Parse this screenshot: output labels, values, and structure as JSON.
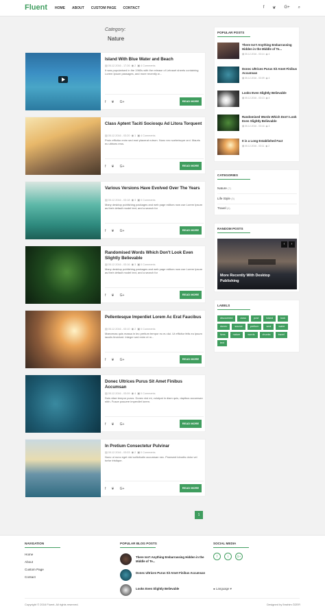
{
  "header": {
    "logo": "Fluent",
    "nav": [
      "HOME",
      "ABOUT",
      "CUSTOM PAGE",
      "CONTACT"
    ],
    "icons": [
      "f",
      "❦",
      "G+",
      "⌕"
    ]
  },
  "category": {
    "label": "Category:",
    "name": "Nature"
  },
  "posts": [
    {
      "title": "Island With Blue Water and Beach",
      "date": "05.12.2016 - 17:26",
      "views": "2",
      "comments": "4 Comments",
      "excerpt": "It was popularised in the 1960s with the release of Letraset sheets containing Lorem Ipsum passages, and more recently w...",
      "more": "READ MORE"
    },
    {
      "title": "Class Aptent Taciti Sociosqu Ad Litora Torquent",
      "date": "05.12.2016 - 03:20",
      "views": "1",
      "comments": "4 Comments",
      "excerpt": "Proin efficitur enim sed erat placerat rutrum. Nunc nec scelerisque orci. Mauris eu ultrices eros.",
      "more": "READ MORE"
    },
    {
      "title": "Various Versions Have Evolved Over The Years",
      "date": "05.12.2016 - 03:18",
      "views": "3",
      "comments": "0 Comments",
      "excerpt": "Many desktop publishing packages and web page editors now use Lorem Ipsum as their default model text, and a search for",
      "more": "READ MORE"
    },
    {
      "title": "Randomised Words Which Don't Look Even Slightly Believable",
      "date": "05.12.2016 - 03:16",
      "views": "3",
      "comments": "0 Comments",
      "excerpt": "Many desktop publishing packages and web page editors now use Lorem Ipsum as their default model text, and a search for",
      "more": "READ MORE"
    },
    {
      "title": "Pellentesque Imperdiet Lorem Ac Erat Faucibus",
      "date": "05.12.2016 - 03:10",
      "views": "2",
      "comments": "0 Comments",
      "excerpt": "Maecenas quis massa in leo pretium tempor eu eu dui. Ut efficitur felis eu ipsum iaculis tincidunt. Integer sed enim et m...",
      "more": "READ MORE"
    },
    {
      "title": "Donec Ultrices Purus Sit Amet Finibus Accumsan",
      "date": "05.12.2016 - 03:09",
      "views": "4",
      "comments": "0 Comments",
      "excerpt": "Duis vitae tempor purus. Donec nisl mi, volutpat in diam quis, dapibus accumsan nibh. Fusce posuere imperdiet lorem.",
      "more": "READ MORE"
    },
    {
      "title": "In Pretium Consectetur Pulvinar",
      "date": "05.12.2016 - 03:03",
      "views": "2",
      "comments": "0 Comments",
      "excerpt": "Nunc ut nunc eget nisl sollicitudin accumsan nec. Praesent lobortis dolor vel tortor tristique.",
      "more": "READ MORE"
    }
  ],
  "pager": "1",
  "sidebar": {
    "popular_title": "POPULAR POSTS",
    "popular": [
      {
        "title": "There Isn't Anything Embarrassing Hidden in the Middle of Te...",
        "meta": "05.12.2016 - 03:14",
        "v": "4"
      },
      {
        "title": "Donec Ultrices Purus Sit Amet Finibus Accumsan",
        "meta": "05.12.2016 - 03:09",
        "v": "4"
      },
      {
        "title": "Looks Even Slightly Believable",
        "meta": "05.12.2016 - 03:13",
        "v": "4"
      },
      {
        "title": "Randomised Words Which Don't Look Even Slightly Believable",
        "meta": "05.12.2016 - 03:16",
        "v": "3"
      },
      {
        "title": "It is a Long Established Fact",
        "meta": "05.12.2016 - 03:11",
        "v": "2"
      }
    ],
    "categories_title": "CATEGORIES",
    "categories": [
      {
        "name": "Nature",
        "count": "(7)"
      },
      {
        "name": "Life Style",
        "count": "(5)"
      },
      {
        "name": "Travel",
        "count": "(6)"
      }
    ],
    "random_title": "RANDOM POSTS",
    "random_post": "More Recently With Desktop Publishing",
    "labels_title": "LABELS",
    "labels": [
      "discovered",
      "class",
      "post",
      "island",
      "look",
      "donec",
      "source",
      "pretium",
      "seal",
      "water",
      "lives",
      "nature",
      "words",
      "chunks",
      "travel",
      "text"
    ]
  },
  "footer": {
    "nav_title": "NAVIGATION",
    "nav": [
      "Home",
      "About",
      "Custom Page",
      "Contact"
    ],
    "popular_title": "POPULAR BLOG POSTS",
    "popular": [
      "There Isn't Anything Embarrassing Hidden in the Middle of Te...",
      "Donec Ultrices Purus Sit Amet Finibus Accumsan",
      "Looks Even Slightly Believable"
    ],
    "social_title": "SOCIAL MEDIA",
    "social": [
      "f",
      "t",
      "G+"
    ],
    "language": "Language",
    "copyright": "Copyright © 2016 Fluent. All rights reserved.",
    "designer": "Designed by İbrahim ÖZER"
  }
}
